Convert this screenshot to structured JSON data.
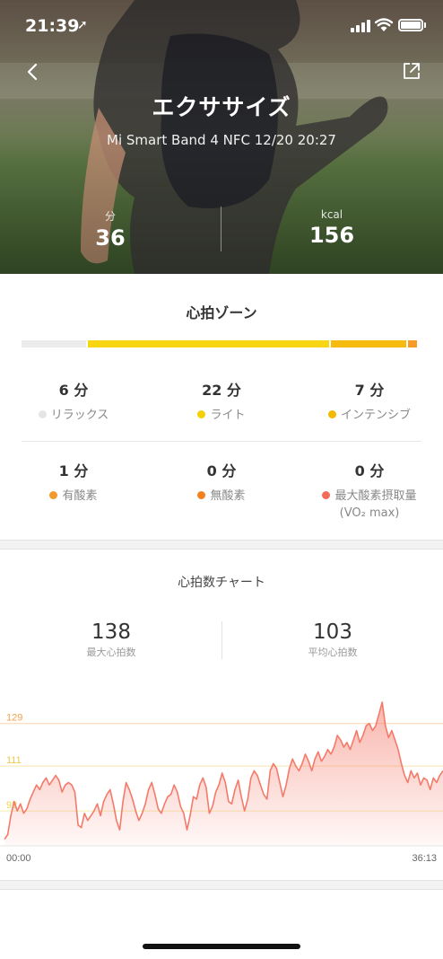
{
  "status_bar": {
    "time": "21:39",
    "location_glyph": "➚"
  },
  "header": {
    "title": "エクササイズ",
    "subtitle": "Mi Smart Band 4 NFC 12/20 20:27",
    "stats": [
      {
        "unit": "分",
        "value": "36"
      },
      {
        "unit": "kcal",
        "value": "156"
      }
    ]
  },
  "heart_zones": {
    "title": "心拍ゾーン",
    "bar_fractions": [
      0.167,
      0.611,
      0.194,
      0.028
    ],
    "bar_colors": [
      "#ebebeb",
      "#f8d613",
      "#f7bb10",
      "#f89a26"
    ],
    "zones": [
      {
        "value": "6 分",
        "label": "リラックス",
        "color": "#e5e5e5"
      },
      {
        "value": "22 分",
        "label": "ライト",
        "color": "#f5d000"
      },
      {
        "value": "7 分",
        "label": "インテンシブ",
        "color": "#f3b800"
      },
      {
        "value": "1 分",
        "label": "有酸素",
        "color": "#f39a2c"
      },
      {
        "value": "0 分",
        "label": "無酸素",
        "color": "#f3821e"
      },
      {
        "value": "0 分",
        "label": "最大酸素摂取量",
        "label2": "(VO₂ max)",
        "color": "#f26b5b"
      }
    ]
  },
  "hr_chart": {
    "title": "心拍数チャート",
    "max": {
      "value": "138",
      "label": "最大心拍数"
    },
    "avg": {
      "value": "103",
      "label": "平均心拍数"
    },
    "x_start": "00:00",
    "x_end": "36:13"
  },
  "chart_data": {
    "type": "area",
    "title": "心拍数チャート",
    "y_reference_lines": [
      {
        "value": 129,
        "color": "#f5a04a"
      },
      {
        "value": 111,
        "color": "#efc84a"
      },
      {
        "value": 92,
        "color": "#e8d84a"
      }
    ],
    "xlim": [
      "00:00",
      "36:13"
    ],
    "line_color": "#f47a6a",
    "fill_color": "#fbd3cd",
    "values": [
      80,
      82,
      90,
      96,
      92,
      95,
      91,
      93,
      97,
      100,
      103,
      101,
      104,
      106,
      103,
      105,
      107,
      105,
      100,
      103,
      104,
      103,
      100,
      86,
      85,
      91,
      88,
      90,
      92,
      95,
      90,
      96,
      99,
      101,
      95,
      88,
      84,
      96,
      104,
      101,
      97,
      92,
      88,
      91,
      95,
      101,
      104,
      99,
      93,
      91,
      95,
      98,
      99,
      103,
      100,
      94,
      91,
      84,
      90,
      98,
      97,
      103,
      106,
      102,
      91,
      94,
      100,
      103,
      108,
      104,
      96,
      95,
      101,
      105,
      98,
      92,
      97,
      106,
      109,
      107,
      103,
      99,
      97,
      109,
      112,
      110,
      104,
      98,
      103,
      110,
      114,
      111,
      109,
      112,
      116,
      113,
      109,
      114,
      117,
      113,
      115,
      118,
      116,
      119,
      124,
      122,
      119,
      121,
      118,
      122,
      126,
      121,
      124,
      128,
      129,
      126,
      128,
      133,
      138,
      128,
      123,
      126,
      122,
      118,
      112,
      107,
      104,
      109,
      106,
      108,
      103,
      106,
      105,
      101,
      106,
      104,
      107,
      109
    ]
  }
}
